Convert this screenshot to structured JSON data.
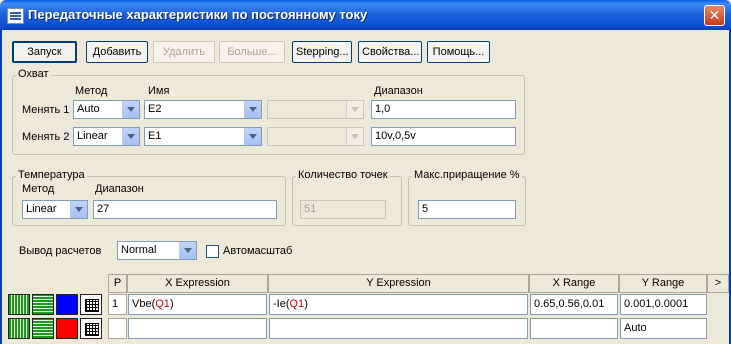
{
  "window": {
    "title": "Передаточные характеристики по постоянному току",
    "close_label": "✕"
  },
  "toolbar": {
    "run": "Запуск",
    "add": "Добавить",
    "delete": "Удалить",
    "more": "Больше...",
    "stepping": "Stepping...",
    "properties": "Свойства...",
    "help": "Помощь..."
  },
  "sweep": {
    "legend": "Охват",
    "method_header": "Метод",
    "name_header": "Имя",
    "range_header": "Диапазон",
    "rows": [
      {
        "label": "Менять 1",
        "method": "Auto",
        "name": "E2",
        "extra": "",
        "range": "1,0"
      },
      {
        "label": "Менять 2",
        "method": "Linear",
        "name": "E1",
        "extra": "",
        "range": "10v,0,5v"
      }
    ]
  },
  "temperature": {
    "legend": "Температура",
    "method_header": "Метод",
    "range_header": "Диапазон",
    "method": "Linear",
    "range": "27"
  },
  "points": {
    "legend": "Количество точек",
    "value": "51"
  },
  "max_step": {
    "legend": "Макс.приращение %",
    "value": "5"
  },
  "output": {
    "label": "Вывод расчетов",
    "value": "Normal",
    "autoscale_label": "Автомасштаб",
    "autoscale_checked": false
  },
  "grid": {
    "headers": {
      "p": "P",
      "x_expr": "X Expression",
      "y_expr": "Y Expression",
      "x_range": "X Range",
      "y_range": "Y Range",
      "more": ">"
    },
    "rows": [
      {
        "p": "1",
        "x_expr_prefix": "Vbe(",
        "x_expr_arg": "Q1",
        "x_expr_suffix": ")",
        "y_expr_prefix": "-Ie(",
        "y_expr_arg": "Q1",
        "y_expr_suffix": ")",
        "x_range": "0.65,0.56,0.01",
        "y_range": "0.001,0.0001",
        "color": "#0000ff"
      },
      {
        "p": "",
        "x_expr_prefix": "",
        "x_expr_arg": "",
        "x_expr_suffix": "",
        "y_expr_prefix": "",
        "y_expr_arg": "",
        "y_expr_suffix": "",
        "x_range": "",
        "y_range": "Auto",
        "color": "#ff0000"
      }
    ]
  }
}
